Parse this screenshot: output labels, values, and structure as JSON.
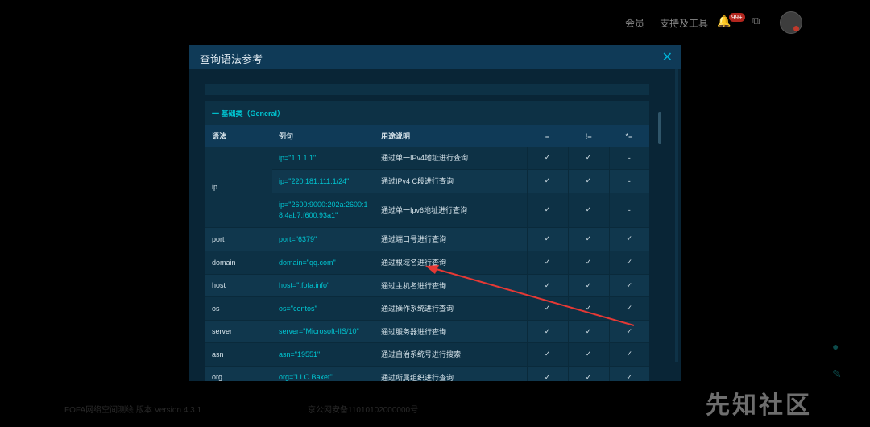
{
  "topbar": {
    "member": "会员",
    "tools": "支持及工具",
    "notif_count": "99+"
  },
  "modal": {
    "title": "查询语法参考",
    "section_title": "一 基础类（General）",
    "headers": [
      "语法",
      "例句",
      "用途说明",
      "=",
      "!=",
      "*="
    ],
    "ip_rows": [
      {
        "example": "ip=\"1.1.1.1\"",
        "desc": "通过单一IPv4地址进行查询",
        "eq": "✓",
        "ne": "✓",
        "like": "-"
      },
      {
        "example": "ip=\"220.181.111.1/24\"",
        "desc": "通过IPv4 C段进行查询",
        "eq": "✓",
        "ne": "✓",
        "like": "-"
      },
      {
        "example": "ip=\"2600:9000:202a:2600:18:4ab7:f600:93a1\"",
        "desc": "通过单一Ipv6地址进行查询",
        "eq": "✓",
        "ne": "✓",
        "like": "-"
      }
    ],
    "ip_label": "ip",
    "rows": [
      {
        "syntax": "port",
        "example": "port=\"6379\"",
        "desc": "通过端口号进行查询",
        "eq": "✓",
        "ne": "✓",
        "like": "✓"
      },
      {
        "syntax": "domain",
        "example": "domain=\"qq.com\"",
        "desc": "通过根域名进行查询",
        "eq": "✓",
        "ne": "✓",
        "like": "✓"
      },
      {
        "syntax": "host",
        "example": "host=\".fofa.info\"",
        "desc": "通过主机名进行查询",
        "eq": "✓",
        "ne": "✓",
        "like": "✓"
      },
      {
        "syntax": "os",
        "example": "os=\"centos\"",
        "desc": "通过操作系统进行查询",
        "eq": "✓",
        "ne": "✓",
        "like": "✓"
      },
      {
        "syntax": "server",
        "example": "server=\"Microsoft-IIS/10\"",
        "desc": "通过服务器进行查询",
        "eq": "✓",
        "ne": "✓",
        "like": "✓"
      },
      {
        "syntax": "asn",
        "example": "asn=\"19551\"",
        "desc": "通过自治系统号进行搜索",
        "eq": "✓",
        "ne": "✓",
        "like": "✓"
      },
      {
        "syntax": "org",
        "example": "org=\"LLC Baxet\"",
        "desc": "通过所属组织进行查询",
        "eq": "✓",
        "ne": "✓",
        "like": "✓"
      }
    ]
  },
  "footer": {
    "text": "FOFA网络空间测绘 版本 Version 4.3.1",
    "text2": "京公网安备11010102000000号"
  },
  "watermark": "先知社区",
  "colors": {
    "accent": "#00c6d2",
    "modal_bg": "#0b2c3f",
    "arrow": "#e53935"
  }
}
